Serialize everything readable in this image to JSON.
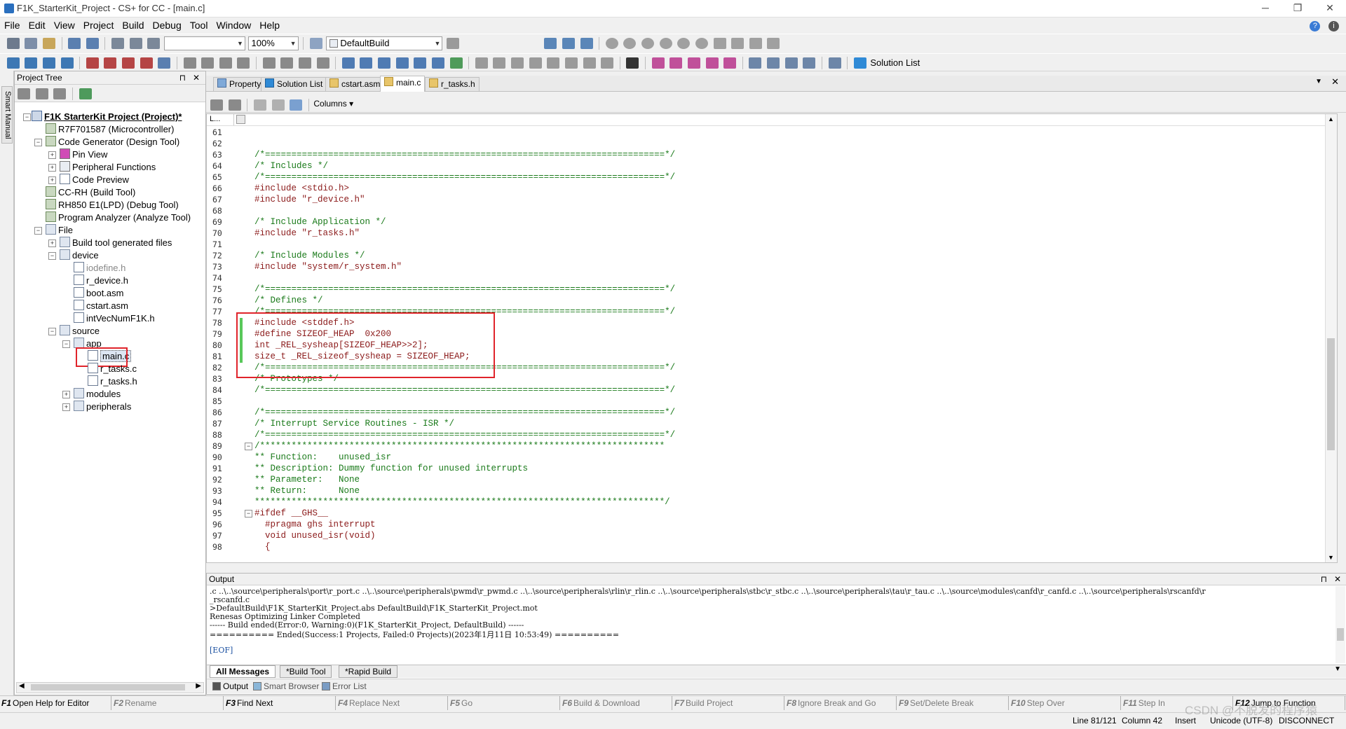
{
  "window": {
    "title": "F1K_StarterKit_Project - CS+ for CC - [main.c]",
    "min": "─",
    "max": "❐",
    "close": "✕"
  },
  "menu": [
    "File",
    "Edit",
    "View",
    "Project",
    "Build",
    "Debug",
    "Tool",
    "Window",
    "Help"
  ],
  "toolbar": {
    "zoom": "100%",
    "build_config": "DefaultBuild",
    "solution_list": "Solution List"
  },
  "side_tab": "Smart Manual",
  "tree": {
    "panel_title": "Project Tree",
    "pin": "⊓",
    "close": "✕",
    "nodes": [
      {
        "label": "F1K StarterKit Project (Project)*"
      },
      {
        "label": "R7F701587 (Microcontroller)"
      },
      {
        "label": "Code Generator (Design Tool)"
      },
      {
        "label": "Pin View"
      },
      {
        "label": "Peripheral Functions"
      },
      {
        "label": "Code Preview"
      },
      {
        "label": "CC-RH (Build Tool)"
      },
      {
        "label": "RH850 E1(LPD) (Debug Tool)"
      },
      {
        "label": "Program Analyzer (Analyze Tool)"
      },
      {
        "label": "File"
      },
      {
        "label": "Build tool generated files"
      },
      {
        "label": "device"
      },
      {
        "label": "iodefine.h"
      },
      {
        "label": "r_device.h"
      },
      {
        "label": "boot.asm"
      },
      {
        "label": "cstart.asm"
      },
      {
        "label": "intVecNumF1K.h"
      },
      {
        "label": "source"
      },
      {
        "label": "app"
      },
      {
        "label": "main.c"
      },
      {
        "label": "r_tasks.c"
      },
      {
        "label": "r_tasks.h"
      },
      {
        "label": "modules"
      },
      {
        "label": "peripherals"
      }
    ]
  },
  "editor_tabs": [
    "Property",
    "Solution List",
    "cstart.asm",
    "main.c",
    "r_tasks.h"
  ],
  "editor_toolbar": {
    "columns": "Columns"
  },
  "editor": {
    "gutter_label": "L...",
    "lines": [
      {
        "n": "61",
        "t": ""
      },
      {
        "n": "62",
        "t": ""
      },
      {
        "n": "63",
        "t": "/*============================================================================*/",
        "c": "cmt"
      },
      {
        "n": "64",
        "t": "/* Includes */",
        "c": "cmt"
      },
      {
        "n": "65",
        "t": "/*============================================================================*/",
        "c": "cmt"
      },
      {
        "n": "66",
        "t": "#include <stdio.h>",
        "c": "pp"
      },
      {
        "n": "67",
        "t": "#include \"r_device.h\"",
        "c": "pp"
      },
      {
        "n": "68",
        "t": ""
      },
      {
        "n": "69",
        "t": "/* Include Application */",
        "c": "cmt"
      },
      {
        "n": "70",
        "t": "#include \"r_tasks.h\"",
        "c": "pp"
      },
      {
        "n": "71",
        "t": ""
      },
      {
        "n": "72",
        "t": "/* Include Modules */",
        "c": "cmt"
      },
      {
        "n": "73",
        "t": "#include \"system/r_system.h\"",
        "c": "pp"
      },
      {
        "n": "74",
        "t": ""
      },
      {
        "n": "75",
        "t": "/*============================================================================*/",
        "c": "cmt"
      },
      {
        "n": "76",
        "t": "/* Defines */",
        "c": "cmt"
      },
      {
        "n": "77",
        "t": "/*============================================================================*/",
        "c": "cmt"
      },
      {
        "n": "78",
        "t": "#include <stddef.h>",
        "c": "pp"
      },
      {
        "n": "79",
        "t": "#define SIZEOF_HEAP  0x200",
        "c": "pp"
      },
      {
        "n": "80",
        "t": "int _REL_sysheap[SIZEOF_HEAP>>2];",
        "c": "pp"
      },
      {
        "n": "81",
        "t": "size_t _REL_sizeof_sysheap = SIZEOF_HEAP;",
        "c": "pp"
      },
      {
        "n": "82",
        "t": "/*============================================================================*/",
        "c": "cmt"
      },
      {
        "n": "83",
        "t": "/* Prototypes */",
        "c": "cmt"
      },
      {
        "n": "84",
        "t": "/*============================================================================*/",
        "c": "cmt"
      },
      {
        "n": "85",
        "t": ""
      },
      {
        "n": "86",
        "t": "/*============================================================================*/",
        "c": "cmt"
      },
      {
        "n": "87",
        "t": "/* Interrupt Service Routines - ISR */",
        "c": "cmt"
      },
      {
        "n": "88",
        "t": "/*============================================================================*/",
        "c": "cmt"
      },
      {
        "n": "89",
        "t": "/*****************************************************************************",
        "c": "cmt"
      },
      {
        "n": "90",
        "t": "** Function:    unused_isr",
        "c": "cmt"
      },
      {
        "n": "91",
        "t": "** Description: Dummy function for unused interrupts",
        "c": "cmt"
      },
      {
        "n": "92",
        "t": "** Parameter:   None",
        "c": "cmt"
      },
      {
        "n": "93",
        "t": "** Return:      None",
        "c": "cmt"
      },
      {
        "n": "94",
        "t": "******************************************************************************/",
        "c": "cmt"
      },
      {
        "n": "95",
        "t": "#ifdef __GHS__",
        "c": "pp"
      },
      {
        "n": "96",
        "t": "  #pragma ghs interrupt",
        "c": "pp"
      },
      {
        "n": "97",
        "t": "  void unused_isr(void)",
        "c": "pp"
      },
      {
        "n": "98",
        "t": "  {",
        "c": "pp"
      }
    ]
  },
  "output": {
    "title": "Output",
    "lines": [
      ".c ..\\..\\source\\peripherals\\port\\r_port.c ..\\..\\source\\peripherals\\pwmd\\r_pwmd.c ..\\..\\source\\peripherals\\rlin\\r_rlin.c ..\\..\\source\\peripherals\\stbc\\r_stbc.c ..\\..\\source\\peripherals\\tau\\r_tau.c ..\\..\\source\\modules\\canfd\\r_canfd.c ..\\..\\source\\peripherals\\rscanfd\\r",
      "_rscanfd.c",
      ">DefaultBuild\\F1K_StarterKit_Project.abs DefaultBuild\\F1K_StarterKit_Project.mot",
      "Renesas Optimizing Linker Completed",
      "------ Build ended(Error:0, Warning:0)(F1K_StarterKit_Project, DefaultBuild) ------",
      "========== Ended(Success:1 Projects, Failed:0 Projects)(2023年1月11日 10:53:49) ==========",
      "",
      "[EOF]"
    ],
    "tabs": [
      "All Messages",
      "*Build Tool",
      "*Rapid Build"
    ]
  },
  "bottom_tabs": [
    "Output",
    "Smart Browser",
    "Error List"
  ],
  "fkeys": [
    {
      "key": "F1",
      "label": "Open Help for Editor Panel",
      "enabled": true
    },
    {
      "key": "F2",
      "label": "Rename",
      "enabled": false
    },
    {
      "key": "F3",
      "label": "Find Next",
      "enabled": true
    },
    {
      "key": "F4",
      "label": "Replace Next",
      "enabled": false
    },
    {
      "key": "F5",
      "label": "Go",
      "enabled": false
    },
    {
      "key": "F6",
      "label": "Build & Download",
      "enabled": false
    },
    {
      "key": "F7",
      "label": "Build Project",
      "enabled": false
    },
    {
      "key": "F8",
      "label": "Ignore Break and Go",
      "enabled": false
    },
    {
      "key": "F9",
      "label": "Set/Delete Break",
      "enabled": false
    },
    {
      "key": "F10",
      "label": "Step Over",
      "enabled": false
    },
    {
      "key": "F11",
      "label": "Step In",
      "enabled": false
    },
    {
      "key": "F12",
      "label": "Jump to Function",
      "enabled": true
    }
  ],
  "status": {
    "position": "Line 81/121",
    "column": "Column 42",
    "mode": "Insert",
    "encoding": "Unicode (UTF-8)",
    "connection": "DISCONNECT",
    "watermark": "CSDN @不脱发的程序猿"
  }
}
